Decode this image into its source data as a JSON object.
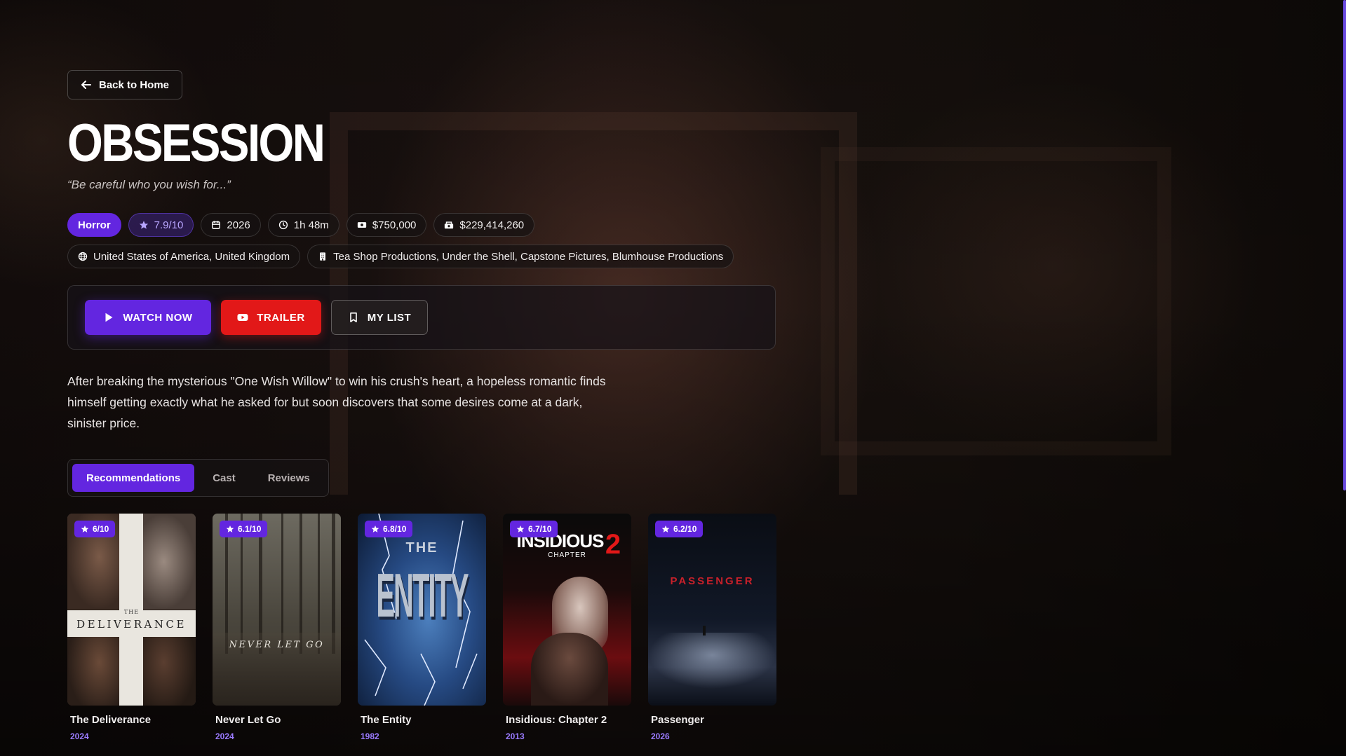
{
  "nav": {
    "back_label": "Back to Home"
  },
  "movie": {
    "title": "OBSESSION",
    "tagline": "“Be careful who you wish for...”",
    "genre": "Horror",
    "rating": "7.9/10",
    "year": "2026",
    "runtime": "1h 48m",
    "budget": "$750,000",
    "revenue": "$229,414,260",
    "countries": "United States of America, United Kingdom",
    "companies": "Tea Shop Productions, Under the Shell, Capstone Pictures, Blumhouse Productions",
    "overview": "After breaking the mysterious \"One Wish Willow\" to win his crush's heart, a hopeless romantic finds himself getting exactly what he asked for but soon discovers that some desires come at a dark, sinister price."
  },
  "actions": {
    "watch_label": "WATCH NOW",
    "trailer_label": "TRAILER",
    "mylist_label": "MY LIST"
  },
  "tabs": [
    {
      "label": "Recommendations",
      "active": true
    },
    {
      "label": "Cast",
      "active": false
    },
    {
      "label": "Reviews",
      "active": false
    }
  ],
  "recommendations": [
    {
      "title": "The Deliverance",
      "year": "2024",
      "rating": "6/10",
      "poster_text": "DELIVERANCE",
      "poster_subtext": "THE"
    },
    {
      "title": "Never Let Go",
      "year": "2024",
      "rating": "6.1/10",
      "poster_text": "NEVER LET GO"
    },
    {
      "title": "The Entity",
      "year": "1982",
      "rating": "6.8/10",
      "poster_text": "ENTITY",
      "poster_subtext": "THE"
    },
    {
      "title": "Insidious: Chapter 2",
      "year": "2013",
      "rating": "6.7/10",
      "poster_text": "INSIDIOUS",
      "poster_subtext": "CHAPTER",
      "poster_number": "2"
    },
    {
      "title": "Passenger",
      "year": "2026",
      "rating": "6.2/10",
      "poster_text": "PASSENGER"
    }
  ],
  "colors": {
    "accent": "#6326e0",
    "trailer": "#e21818",
    "year_text": "#9b7bff"
  },
  "icons": {
    "back": "arrow-left-icon",
    "rating": "star-icon",
    "year": "calendar-icon",
    "runtime": "clock-icon",
    "budget": "money-icon",
    "revenue": "revenue-icon",
    "countries": "globe-icon",
    "companies": "building-icon",
    "watch": "play-icon",
    "trailer": "youtube-icon",
    "mylist": "bookmark-icon"
  }
}
